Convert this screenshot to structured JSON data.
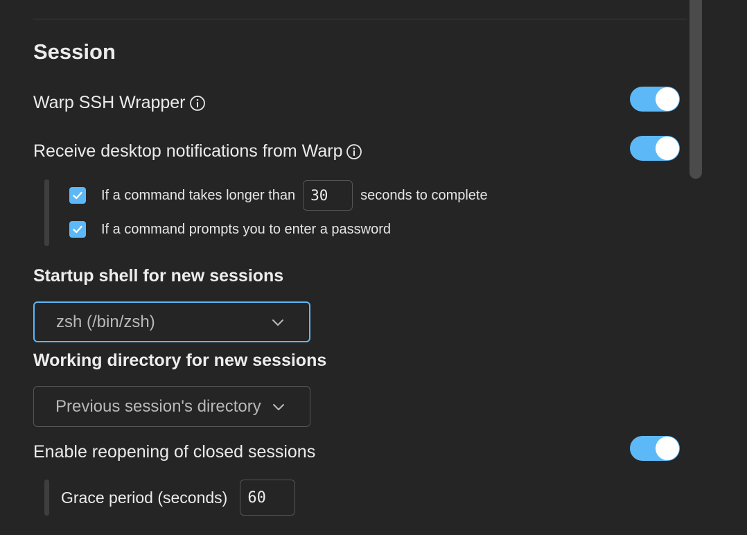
{
  "section": {
    "title": "Session"
  },
  "ssh_wrapper": {
    "label": "Warp SSH Wrapper",
    "icon": "info-icon",
    "enabled": true
  },
  "notifications": {
    "label": "Receive desktop notifications from Warp",
    "icon": "info-icon",
    "enabled": true,
    "long_command": {
      "checked": true,
      "label_before": "If a command takes longer than",
      "seconds_value": "30",
      "label_after": "seconds to complete"
    },
    "password_prompt": {
      "checked": true,
      "label": "If a command prompts you to enter a password"
    }
  },
  "startup_shell": {
    "heading": "Startup shell for new sessions",
    "selected": "zsh (/bin/zsh)"
  },
  "working_directory": {
    "heading": "Working directory for new sessions",
    "selected": "Previous session's directory"
  },
  "reopen_sessions": {
    "label": "Enable reopening of closed sessions",
    "enabled": true,
    "grace_period_label": "Grace period (seconds)",
    "grace_period_value": "60"
  },
  "colors": {
    "background": "#252525",
    "accent": "#5db8f7",
    "text": "#e9e9e9",
    "border": "#555555"
  }
}
